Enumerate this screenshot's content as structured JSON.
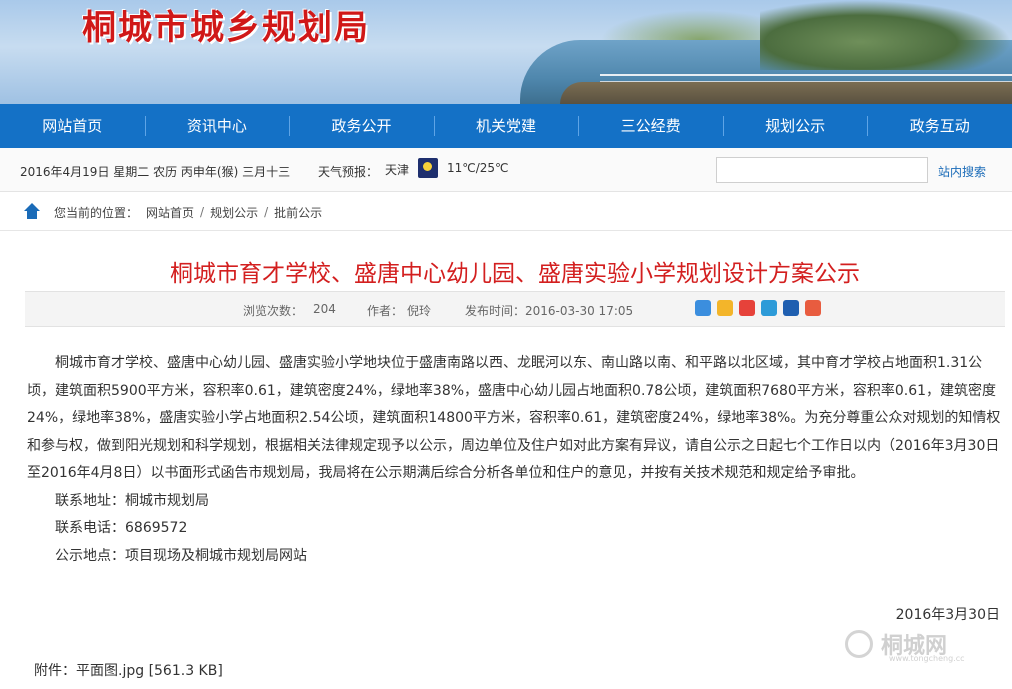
{
  "site": {
    "title": "桐城市城乡规划局"
  },
  "nav": {
    "items": [
      "网站首页",
      "资讯中心",
      "政务公开",
      "机关党建",
      "三公经费",
      "规划公示",
      "政务互动"
    ]
  },
  "infobar": {
    "date": "2016年4月19日 星期二 农历 丙申年(猴) 三月十三",
    "weather_label": "天气预报：",
    "city": "天津",
    "temperature": "11℃/25℃",
    "search_placeholder": "",
    "search_button": "站内搜索"
  },
  "breadcrumb": {
    "prefix": "您当前的位置：",
    "items": [
      "网站首页",
      "规划公示",
      "批前公示"
    ]
  },
  "article": {
    "title": "桐城市育才学校、盛唐中心幼儿园、盛唐实验小学规划设计方案公示",
    "meta": {
      "views_label": "浏览次数：",
      "views": "204",
      "author_label": "作者：",
      "author": "倪玲",
      "published": "发布时间：2016-03-30 17:05"
    },
    "share_icons": [
      "plus-share-icon",
      "qzone-icon",
      "weibo-icon",
      "pengyou-icon",
      "renren-icon",
      "kaixin-icon"
    ],
    "paragraph": "桐城市育才学校、盛唐中心幼儿园、盛唐实验小学地块位于盛唐南路以西、龙眠河以东、南山路以南、和平路以北区域，其中育才学校占地面积1.31公顷，建筑面积5900平方米，容积率0.61，建筑密度24%，绿地率38%，盛唐中心幼儿园占地面积0.78公顷，建筑面积7680平方米，容积率0.61，建筑密度24%，绿地率38%，盛唐实验小学占地面积2.54公顷，建筑面积14800平方米，容积率0.61，建筑密度24%，绿地率38%。为充分尊重公众对规划的知情权和参与权，做到阳光规划和科学规划，根据相关法律规定现予以公示，周边单位及住户如对此方案有异议，请自公示之日起七个工作日以内（2016年3月30日至2016年4月8日）以书面形式函告市规划局，我局将在公示期满后综合分析各单位和住户的意见，并按有关技术规范和规定给予审批。",
    "address": "联系地址：桐城市规划局",
    "phone": "联系电话：6869572",
    "location": "公示地点：项目现场及桐城市规划局网站",
    "sign_date": "2016年3月30日",
    "attachment": "附件：平面图.jpg [561.3 KB]"
  },
  "watermark": {
    "text": "桐城网",
    "sub": "www.tongcheng.cc"
  },
  "colors": {
    "nav": "#1471c6",
    "title": "#d31f1f",
    "link": "#1a6bb8"
  }
}
